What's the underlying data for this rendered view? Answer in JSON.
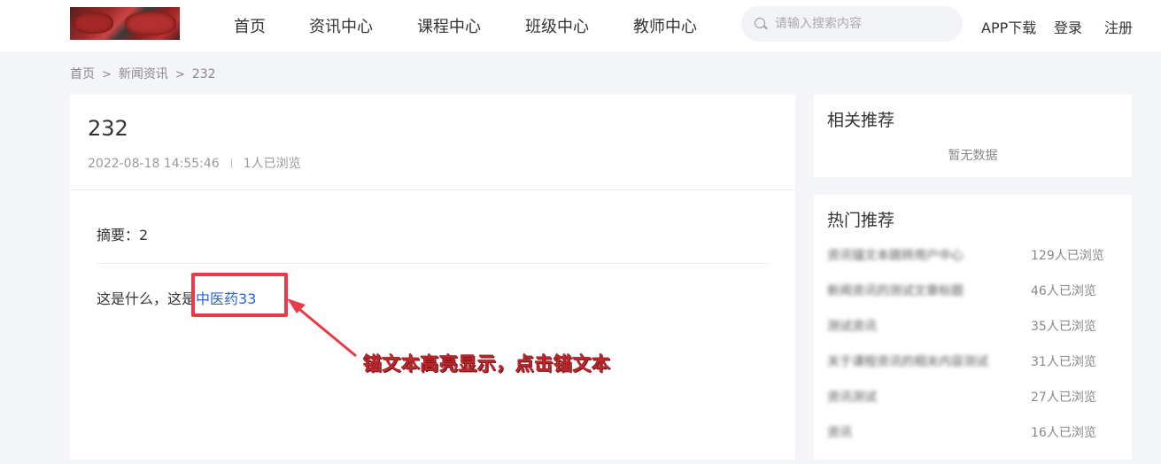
{
  "header": {
    "nav": [
      "首页",
      "资讯中心",
      "课程中心",
      "班级中心",
      "教师中心"
    ],
    "search_placeholder": "请输入搜索内容",
    "app_download": "APP下载",
    "login": "登录",
    "register": "注册"
  },
  "breadcrumb": [
    "首页",
    "新闻资讯",
    "232"
  ],
  "article": {
    "title": "232",
    "date": "2022-08-18 14:55:46",
    "views": "1人已浏览",
    "summary": "摘要：2",
    "body_prefix": "这是什么，这是",
    "anchor_text": "中医药33"
  },
  "annotation": {
    "text": "锚文本高亮显示，点击锚文本",
    "color": "#e83b48"
  },
  "related": {
    "title": "相关推荐",
    "empty": "暂无数据"
  },
  "hot": {
    "title": "热门推荐",
    "items": [
      {
        "name": "资讯锚文本跳转用户中心",
        "views": "129人已浏览"
      },
      {
        "name": "新闻资讯的测试文章标题",
        "views": "46人已浏览"
      },
      {
        "name": "测试资讯",
        "views": "35人已浏览"
      },
      {
        "name": "关于课程资讯的相关内容测试",
        "views": "31人已浏览"
      },
      {
        "name": "资讯测试",
        "views": "27人已浏览"
      },
      {
        "name": "资讯",
        "views": "16人已浏览"
      }
    ]
  },
  "colors": {
    "link": "#2b63d9",
    "background": "#f4f5f9"
  }
}
